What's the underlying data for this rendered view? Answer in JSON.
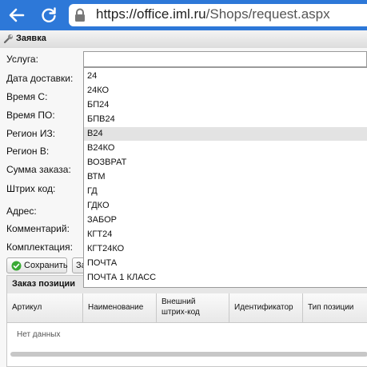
{
  "browser": {
    "url_host": "https://office.iml.ru",
    "url_path": "/Shops/request.aspx"
  },
  "window": {
    "title": "Заявка"
  },
  "form": {
    "labels": {
      "service": "Услуга:",
      "delivery_date": "Дата доставки:",
      "time_from": "Время С:",
      "time_to": "Время ПО:",
      "region_from": "Регион ИЗ:",
      "region_to": "Регион В:",
      "order_sum": "Сумма заказа:",
      "barcode": "Штрих код:",
      "address": "Адрес:",
      "comment": "Комментарий:",
      "kit": "Комплектация:"
    },
    "service_value": "",
    "save_label": "Сохранить",
    "second_button_label": "За"
  },
  "dropdown": {
    "options": [
      "24",
      "24КО",
      "БП24",
      "БПВ24",
      "В24",
      "В24КО",
      "ВОЗВРАТ",
      "ВТМ",
      "ГД",
      "ГДКО",
      "ЗАБОР",
      "КГТ24",
      "КГТ24КО",
      "ПОЧТА",
      "ПОЧТА 1 КЛАСС"
    ],
    "highlighted": "В24"
  },
  "order_panel": {
    "title": "Заказ позиции",
    "columns": [
      "Артикул",
      "Наименование",
      "Внешний штрих-код",
      "Идентификатор",
      "Тип позиции"
    ],
    "empty_text": "Нет данных"
  },
  "colors": {
    "browser_bar": "#2d78d8",
    "highlight": "#e3e3e3",
    "ok_green": "#3aaa35"
  }
}
